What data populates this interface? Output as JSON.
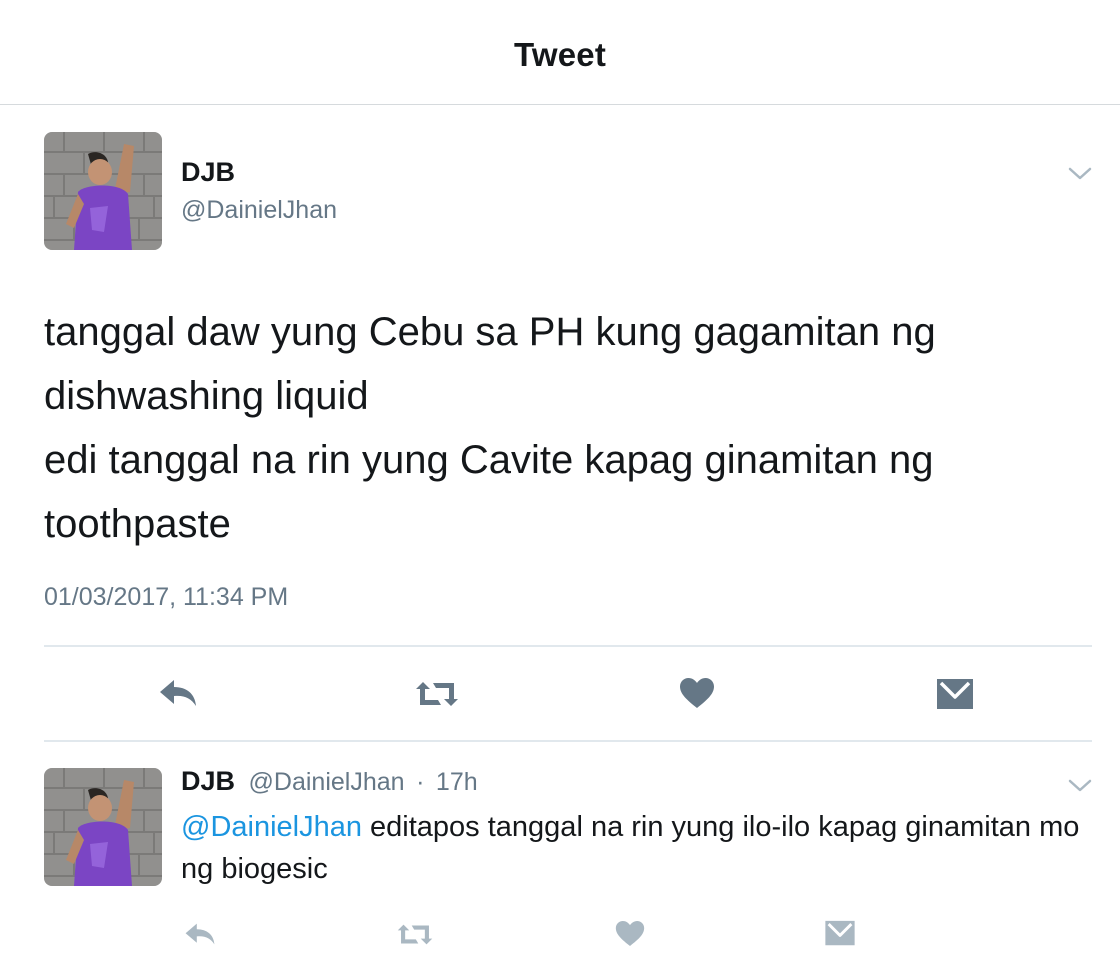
{
  "header": {
    "title": "Tweet"
  },
  "main_tweet": {
    "name": "DJB",
    "handle": "@DainielJhan",
    "text": "tanggal daw yung Cebu sa PH kung gagamitan ng\ndishwashing liquid\nedi tanggal na rin yung Cavite kapag ginamitan ng\ntoothpaste",
    "timestamp": "01/03/2017, 11:34 PM",
    "avatar_icon": "profile-photo"
  },
  "reply_tweet": {
    "name": "DJB",
    "handle": "@DainielJhan",
    "separator": "·",
    "time": "17h",
    "mention": "@DainielJhan",
    "text": " editapos tanggal na rin yung ilo-ilo  kapag ginamitan mo ng biogesic",
    "avatar_icon": "profile-photo"
  },
  "actions": {
    "icons": [
      "reply-icon",
      "retweet-icon",
      "like-icon",
      "direct-message-icon"
    ]
  },
  "colors": {
    "text": "#14171a",
    "secondary": "#657786",
    "link": "#1b95e0",
    "icon": "#657786",
    "divider": "#e1e8ed"
  }
}
